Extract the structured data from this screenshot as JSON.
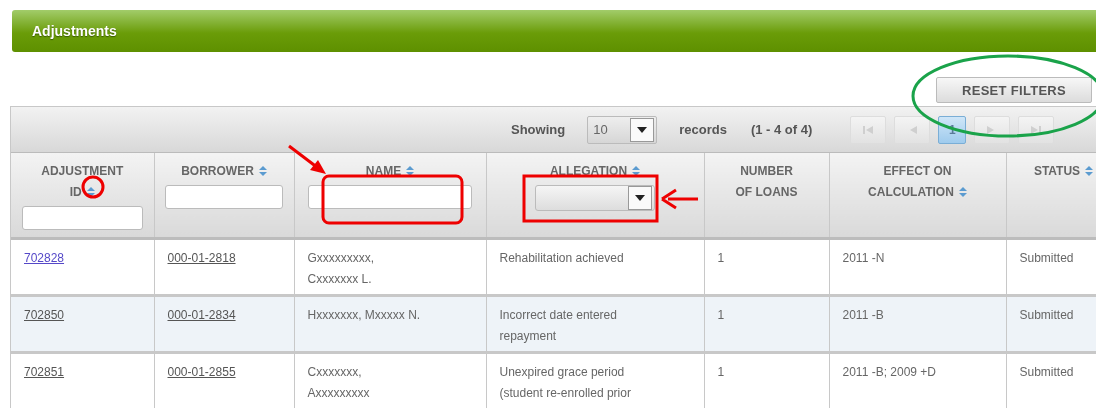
{
  "header": {
    "title": "Adjustments"
  },
  "reset_button": "RESET FILTERS",
  "toolbar": {
    "showing_label": "Showing",
    "page_size": "10",
    "records_label": "records",
    "range": "(1 - 4 of 4)",
    "pages": [
      {
        "label": "1",
        "selected": true
      }
    ]
  },
  "columns": [
    {
      "label_lines": [
        "ADJUSTMENT",
        "ID"
      ],
      "sortable": true,
      "kind": "text-filter",
      "link": true
    },
    {
      "label_lines": [
        "BORROWER"
      ],
      "sortable": true,
      "kind": "text-filter",
      "link": true
    },
    {
      "label_lines": [
        "NAME"
      ],
      "sortable": true,
      "kind": "text-filter",
      "link": false
    },
    {
      "label_lines": [
        "ALLEGATION"
      ],
      "sortable": true,
      "kind": "select-filter",
      "link": false
    },
    {
      "label_lines": [
        "NUMBER",
        "OF LOANS"
      ],
      "sortable": false,
      "kind": "plain",
      "link": false
    },
    {
      "label_lines": [
        "EFFECT ON",
        "CALCULATION"
      ],
      "sortable": true,
      "kind": "plain",
      "link": false
    },
    {
      "label_lines": [
        "STATUS"
      ],
      "sortable": true,
      "kind": "plain",
      "link": false
    }
  ],
  "rows": [
    {
      "visited": true,
      "cells": [
        "702828",
        "000-01-2818",
        "Gxxxxxxxxx,\nCxxxxxxx L.",
        "Rehabilitation achieved",
        "1",
        "2011 -N",
        "Submitted"
      ]
    },
    {
      "visited": false,
      "cells": [
        "702850",
        "000-01-2834",
        "Hxxxxxxx, Mxxxxx N.",
        "Incorrect date entered\nrepayment",
        "1",
        "2011 -B",
        "Submitted"
      ]
    },
    {
      "visited": false,
      "cells": [
        "702851",
        "000-01-2855",
        "Cxxxxxxx,\nAxxxxxxxxx",
        "Unexpired grace period\n(student re-enrolled prior",
        "1",
        "2011 -B; 2009 +D",
        "Submitted"
      ]
    }
  ]
}
